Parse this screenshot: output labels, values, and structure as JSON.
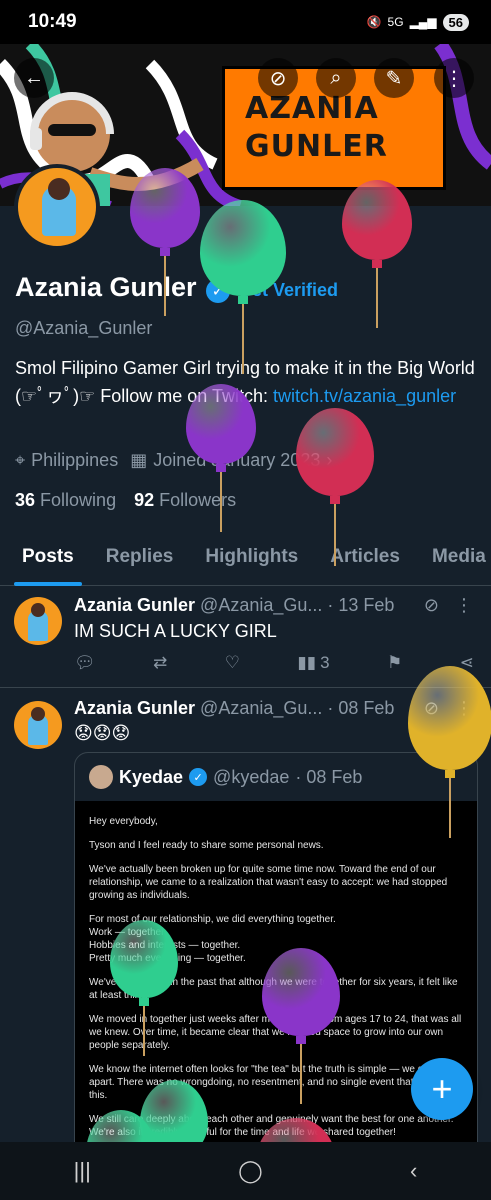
{
  "status_bar": {
    "time": "10:49",
    "icons": [
      "mute-icon",
      "5g-icon",
      "signal-icon"
    ],
    "battery": "56"
  },
  "banner": {
    "logo_line1": "AZANIA",
    "logo_line2": "GUNLER",
    "buttons": [
      "back-arrow-icon",
      "grok-icon",
      "search-icon",
      "edit-icon",
      "more-icon"
    ]
  },
  "profile": {
    "name": "Azania Gunler",
    "get_verified": "Get Verified",
    "handle": "@Azania_Gunler",
    "bio_text": "Smol Filipino Gamer Girl trying to make it in the Big World (☞ﾟヮﾟ)☞ Follow me on Twitch: ",
    "bio_link": "twitch.tv/azania_gunler",
    "location": "Philippines",
    "joined": "Joined January 2023",
    "following_count": "36",
    "following_label": "Following",
    "followers_count": "92",
    "followers_label": "Followers"
  },
  "tabs": [
    "Posts",
    "Replies",
    "Highlights",
    "Articles",
    "Media"
  ],
  "posts": [
    {
      "name": "Azania Gunler",
      "handle": "@Azania_Gu...",
      "date": "· 13 Feb",
      "text": "IM SUCH A LUCKY GIRL",
      "views": "3"
    },
    {
      "name": "Azania Gunler",
      "handle": "@Azania_Gu...",
      "date": "· 08 Feb",
      "text": "😟😟😟",
      "quote": {
        "name": "Kyedae",
        "handle": "@kyedae",
        "date": "· 08 Feb",
        "paragraphs": [
          "Hey everybody,",
          "Tyson and I feel ready to share some personal news.",
          "We've actually been broken up for quite some time now. Toward the end of our relationship, we came to a realization that wasn't easy to accept: we had stopped growing as individuals.",
          "For most of our relationship, we did everything together.\nWork — together.\nHobbies and interests — together.\nPretty much everything — together.",
          "We've even joked in the past that although we were together for six years, it felt like at least thirty.",
          "We moved in together just weeks after meeting, and from ages 17 to 24, that was all we knew. Over time, it became clear that we needed space to grow into our own people separately.",
          "We know the internet often looks for \"the tea\" but the truth is simple — we grew apart. There was no wrongdoing, no resentment, and no single event that caused this.",
          "We still care deeply about each other and genuinely want the best for one another. We're also incredibly grateful for the time and life we shared together!"
        ]
      }
    }
  ],
  "nav_bar": [
    "recent-apps-icon",
    "home-icon",
    "back-icon"
  ],
  "colors": {
    "background": "#15202b",
    "accent": "#1d9bf0",
    "banner_logo": "#ff7a00"
  }
}
